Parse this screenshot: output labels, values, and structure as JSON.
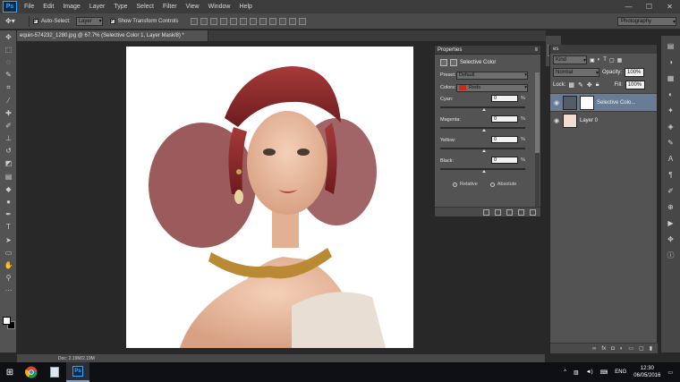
{
  "menu": {
    "logo": "Ps",
    "items": [
      "File",
      "Edit",
      "Image",
      "Layer",
      "Type",
      "Select",
      "Filter",
      "View",
      "Window",
      "Help"
    ],
    "window_controls": [
      "—",
      "☐",
      "✕"
    ]
  },
  "options_bar": {
    "auto_select_label": "Auto-Select:",
    "auto_select_value": "Layer",
    "transform_label": "Show Transform Controls",
    "workspace": "Photography"
  },
  "document": {
    "tab_title": "equin-574232_1280.jpg @ 67.7% (Selective Color 1, Layer Mask/8) *",
    "status": "Doc: 2.19M/2.19M"
  },
  "properties": {
    "header": "Properties",
    "title": "Selective Color",
    "preset_label": "Preset:",
    "preset_value": "Default",
    "colors_label": "Colors:",
    "colors_value": "Reds",
    "sliders": [
      {
        "label": "Cyan:",
        "value": "0"
      },
      {
        "label": "Magenta:",
        "value": "0"
      },
      {
        "label": "Yellow:",
        "value": "0"
      },
      {
        "label": "Black:",
        "value": "0"
      }
    ],
    "percent": "%",
    "relative_label": "Relative",
    "absolute_label": "Absolute",
    "accent_red": "#cc2a16"
  },
  "layers_panel": {
    "header": "es",
    "filter_value": "Kind",
    "blend_mode": "Normal",
    "opacity_label": "Opacity:",
    "opacity_value": "100%",
    "lock_label": "Lock:",
    "fill_label": "Fill:",
    "fill_value": "100%",
    "layers": [
      {
        "name": "Selective Colo...",
        "selected": true
      },
      {
        "name": "Layer 0",
        "selected": false
      }
    ]
  },
  "taskbar": {
    "language": "ENG",
    "time": "12:30",
    "date": "06/05/2016"
  }
}
